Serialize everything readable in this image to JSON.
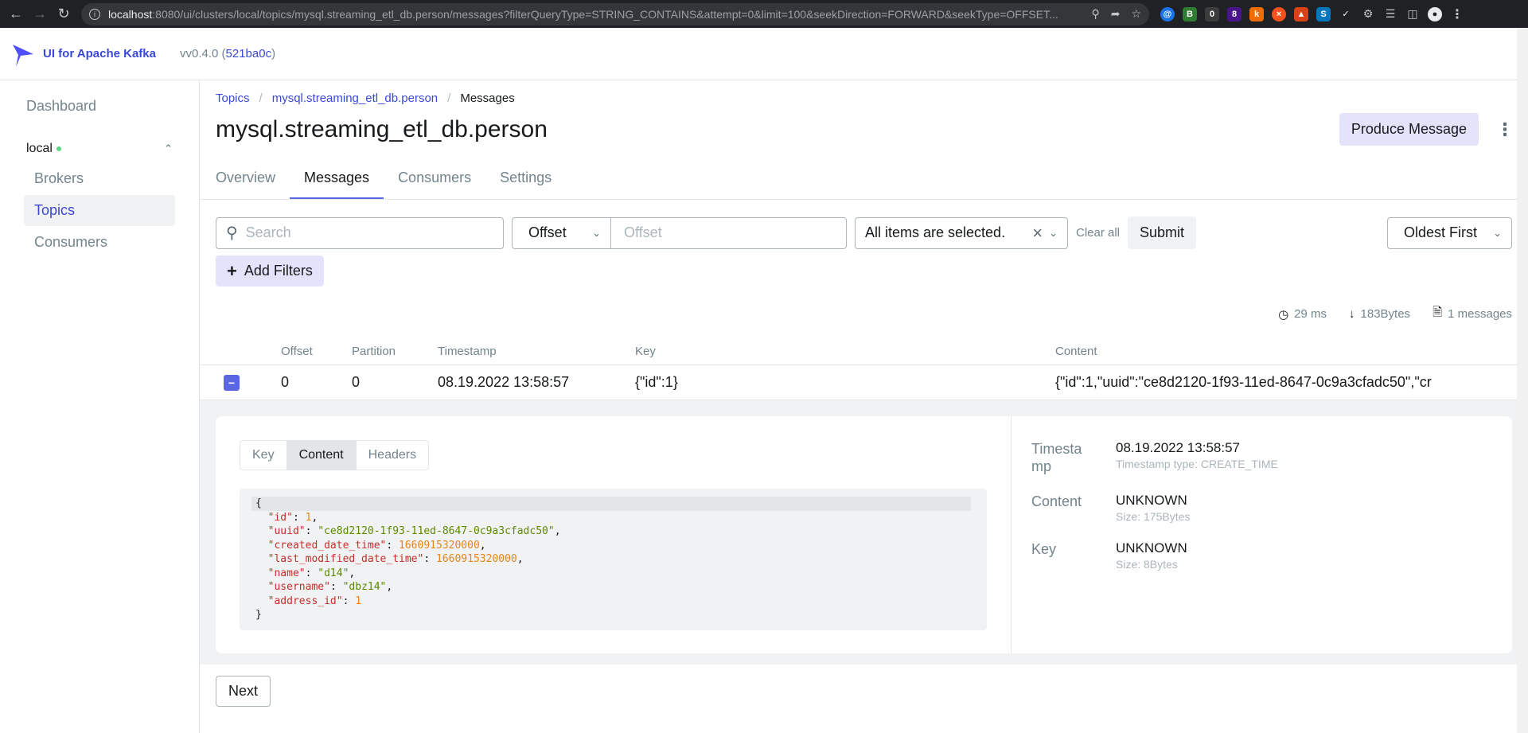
{
  "browser": {
    "url_host": "localhost",
    "url_rest": ":8080/ui/clusters/local/topics/mysql.streaming_etl_db.person/messages?filterQueryType=STRING_CONTAINS&attempt=0&limit=100&seekDirection=FORWARD&seekType=OFFSET..."
  },
  "header": {
    "app_name": "UI for Apache Kafka",
    "version_prefix": "vv0.4.0 (",
    "version_hash": "521ba0c",
    "version_suffix": ")"
  },
  "sidebar": {
    "dashboard": "Dashboard",
    "cluster": "local",
    "items": [
      {
        "label": "Brokers"
      },
      {
        "label": "Topics",
        "active": true
      },
      {
        "label": "Consumers"
      }
    ]
  },
  "breadcrumb": {
    "root": "Topics",
    "topic": "mysql.streaming_etl_db.person",
    "current": "Messages",
    "sep": "/"
  },
  "page": {
    "title": "mysql.streaming_etl_db.person",
    "produce_label": "Produce Message"
  },
  "tabs": [
    "Overview",
    "Messages",
    "Consumers",
    "Settings"
  ],
  "filters": {
    "search_placeholder": "Search",
    "seek_type": "Offset",
    "offset_placeholder": "Offset",
    "partitions": "All items are selected.",
    "clear_all": "Clear all",
    "submit": "Submit",
    "order": "Oldest First",
    "add_filters": "Add Filters"
  },
  "stats": {
    "elapsed": "29 ms",
    "bytes": "183Bytes",
    "messages": "1 messages"
  },
  "table": {
    "headers": [
      "Offset",
      "Partition",
      "Timestamp",
      "Key",
      "Content"
    ],
    "row": {
      "offset": "0",
      "partition": "0",
      "timestamp": "08.19.2022 13:58:57",
      "key": "{\"id\":1}",
      "content": "{\"id\":1,\"uuid\":\"ce8d2120-1f93-11ed-8647-0c9a3cfadc50\",\"cr"
    }
  },
  "detail": {
    "tabs": [
      "Key",
      "Content",
      "Headers"
    ],
    "json": {
      "id": "1",
      "uuid": "\"ce8d2120-1f93-11ed-8647-0c9a3cfadc50\"",
      "created_date_time": "1660915320000",
      "last_modified_date_time": "1660915320000",
      "name": "\"d14\"",
      "username": "\"dbz14\"",
      "address_id": "1"
    },
    "meta": {
      "timestamp_label": "Timestamp",
      "timestamp_value": "08.19.2022 13:58:57",
      "timestamp_type": "Timestamp type: CREATE_TIME",
      "content_label": "Content",
      "content_value": "UNKNOWN",
      "content_size": "Size: 175Bytes",
      "key_label": "Key",
      "key_value": "UNKNOWN",
      "key_size": "Size: 8Bytes"
    }
  },
  "pager": {
    "next": "Next"
  },
  "colors": {
    "accent": "#4f4fff",
    "accent_soft": "#e3e3fc",
    "status_green": "#5cd685"
  }
}
